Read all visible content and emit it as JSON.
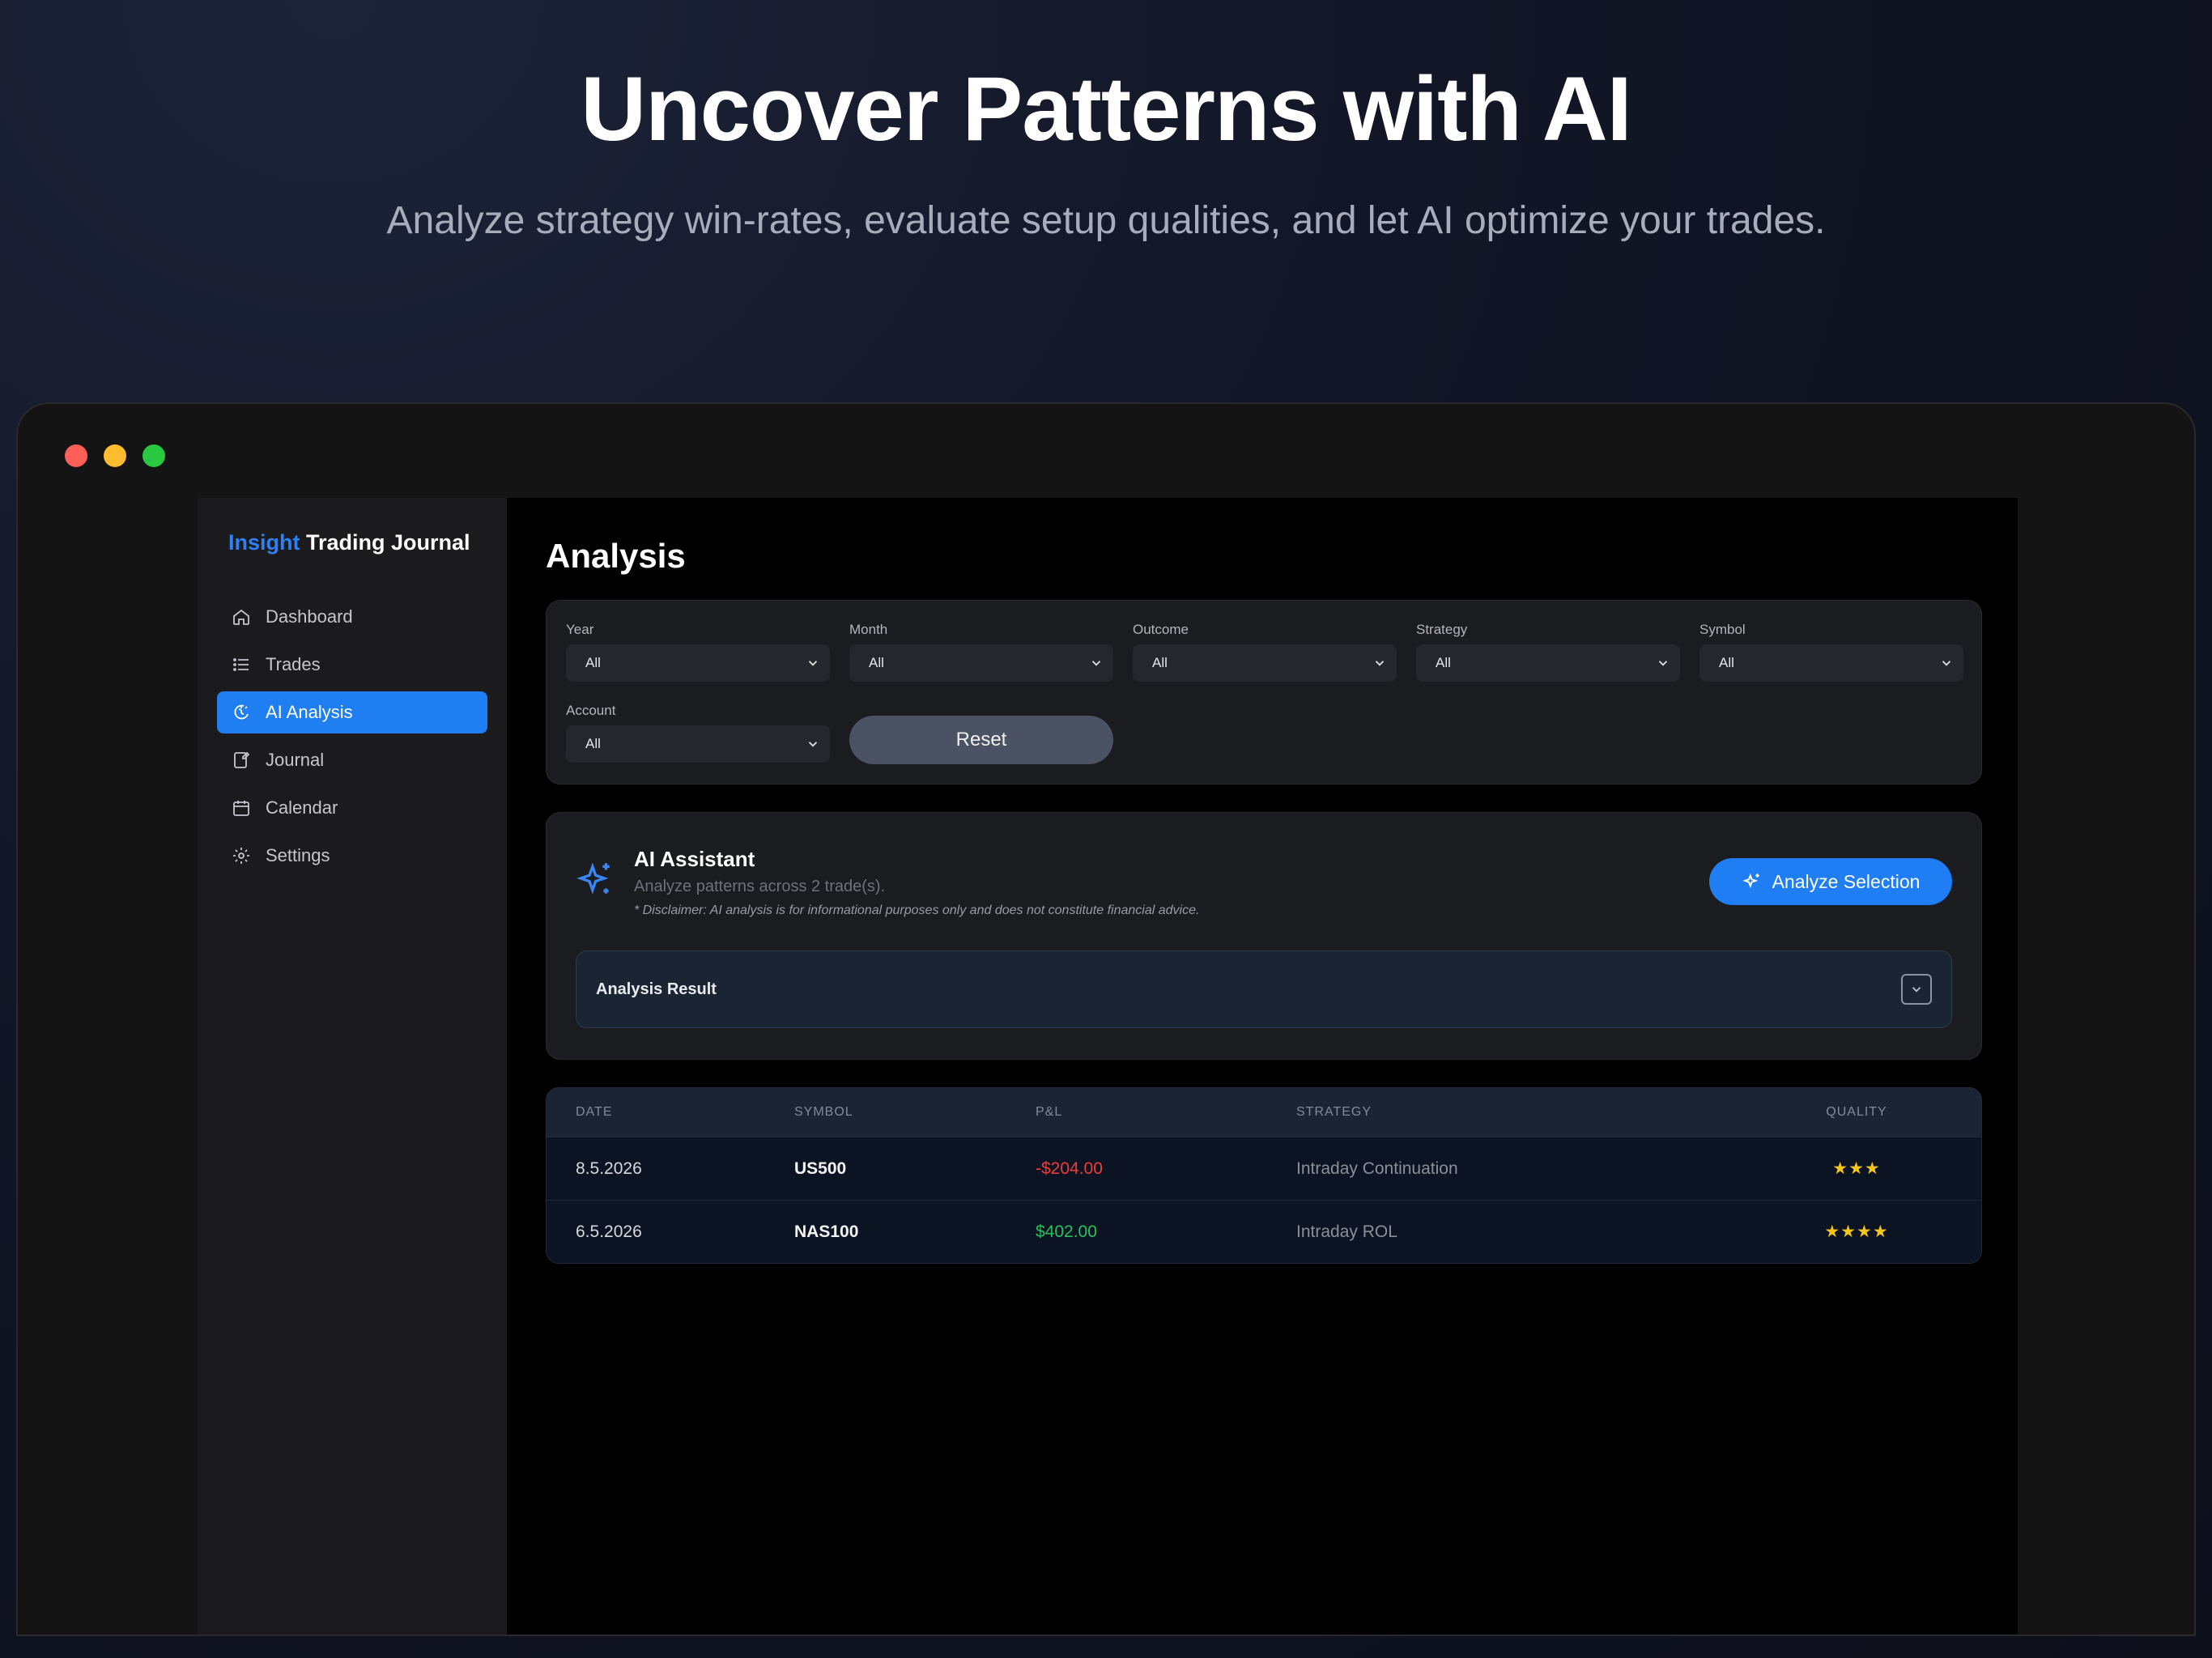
{
  "hero": {
    "title": "Uncover Patterns with AI",
    "subtitle": "Analyze strategy win-rates, evaluate setup qualities, and let AI optimize your trades."
  },
  "brand": {
    "accent": "Insight",
    "rest": "Trading Journal"
  },
  "sidebar": {
    "items": [
      {
        "label": "Dashboard",
        "icon": "home-icon"
      },
      {
        "label": "Trades",
        "icon": "list-icon"
      },
      {
        "label": "AI Analysis",
        "icon": "brain-icon",
        "active": true
      },
      {
        "label": "Journal",
        "icon": "journal-icon"
      },
      {
        "label": "Calendar",
        "icon": "calendar-icon"
      },
      {
        "label": "Settings",
        "icon": "gear-icon"
      }
    ]
  },
  "page": {
    "title": "Analysis"
  },
  "filters": {
    "year": {
      "label": "Year",
      "value": "All"
    },
    "month": {
      "label": "Month",
      "value": "All"
    },
    "outcome": {
      "label": "Outcome",
      "value": "All"
    },
    "strategy": {
      "label": "Strategy",
      "value": "All"
    },
    "symbol": {
      "label": "Symbol",
      "value": "All"
    },
    "account": {
      "label": "Account",
      "value": "All"
    },
    "reset_label": "Reset"
  },
  "assistant": {
    "title": "AI Assistant",
    "description": "Analyze patterns across 2 trade(s).",
    "disclaimer": "* Disclaimer: AI analysis is for informational purposes only and does not constitute financial advice.",
    "analyze_label": "Analyze Selection",
    "result_label": "Analysis Result"
  },
  "table": {
    "headers": {
      "date": "DATE",
      "symbol": "SYMBOL",
      "pnl": "P&L",
      "strategy": "STRATEGY",
      "quality": "QUALITY"
    },
    "rows": [
      {
        "date": "8.5.2026",
        "symbol": "US500",
        "pnl": "-$204.00",
        "strategy": "Intraday Continuation",
        "quality": "★★★"
      },
      {
        "date": "6.5.2026",
        "symbol": "NAS100",
        "pnl": "$402.00",
        "strategy": "Intraday ROL",
        "quality": "★★★★"
      }
    ]
  },
  "colors": {
    "accent": "#1e7ef2",
    "loss": "#ef3b3b",
    "gain": "#24c25e",
    "star": "#f5c518"
  }
}
